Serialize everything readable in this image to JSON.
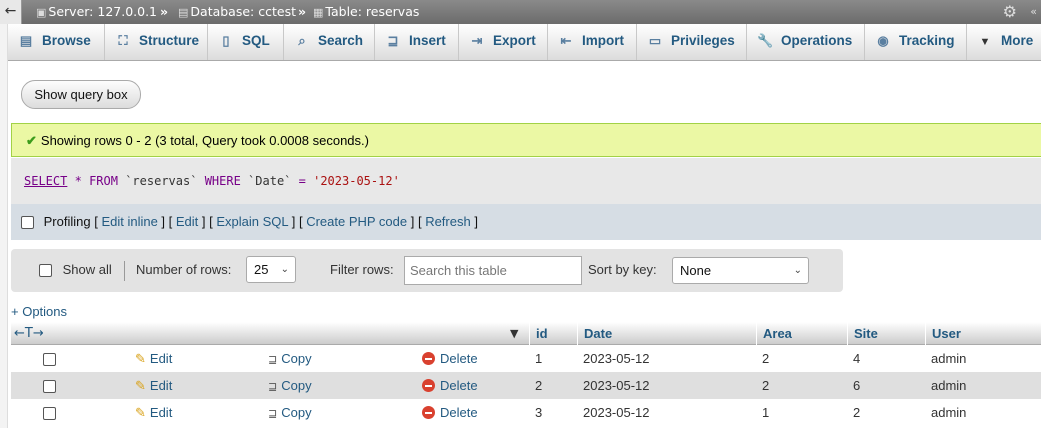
{
  "breadcrumb": {
    "server": "Server: 127.0.0.1",
    "database": "Database: cctest",
    "table": "Table: reservas",
    "separator": "»"
  },
  "tabs": [
    {
      "label": "Browse",
      "icon": "browse-icon"
    },
    {
      "label": "Structure",
      "icon": "structure-icon"
    },
    {
      "label": "SQL",
      "icon": "sql-icon"
    },
    {
      "label": "Search",
      "icon": "search-icon"
    },
    {
      "label": "Insert",
      "icon": "insert-icon"
    },
    {
      "label": "Export",
      "icon": "export-icon"
    },
    {
      "label": "Import",
      "icon": "import-icon"
    },
    {
      "label": "Privileges",
      "icon": "privileges-icon"
    },
    {
      "label": "Operations",
      "icon": "wrench-icon"
    },
    {
      "label": "Tracking",
      "icon": "eye-icon"
    },
    {
      "label": "More",
      "icon": "caret-down-icon"
    }
  ],
  "query_box_button": "Show query box",
  "success_message": "Showing rows 0 - 2 (3 total, Query took 0.0008 seconds.)",
  "sql": {
    "select": "SELECT",
    "star": "*",
    "from": "FROM",
    "table": "`reservas`",
    "where": "WHERE",
    "column": "`Date`",
    "equals": "=",
    "value": "'2023-05-12'"
  },
  "profiling": {
    "label": "Profiling",
    "links": [
      "Edit inline",
      "Edit",
      "Explain SQL",
      "Create PHP code",
      "Refresh"
    ]
  },
  "nav": {
    "show_all": "Show all",
    "rows_label": "Number of rows:",
    "rows_value": "25",
    "filter_label": "Filter rows:",
    "filter_placeholder": "Search this table",
    "sort_label": "Sort by key:",
    "sort_value": "None"
  },
  "options_link": "+ Options",
  "table": {
    "columns": [
      "id",
      "Date",
      "Area",
      "Site",
      "User"
    ],
    "actions": {
      "edit": "Edit",
      "copy": "Copy",
      "delete": "Delete"
    },
    "rows": [
      {
        "id": "1",
        "date": "2023-05-12",
        "area": "2",
        "site": "4",
        "user": "admin"
      },
      {
        "id": "2",
        "date": "2023-05-12",
        "area": "2",
        "site": "6",
        "user": "admin"
      },
      {
        "id": "3",
        "date": "2023-05-12",
        "area": "1",
        "site": "2",
        "user": "admin"
      }
    ]
  },
  "colors": {
    "link": "#235a81",
    "success_bg": "#ebf8a4",
    "delete_icon": "#d9412f"
  }
}
